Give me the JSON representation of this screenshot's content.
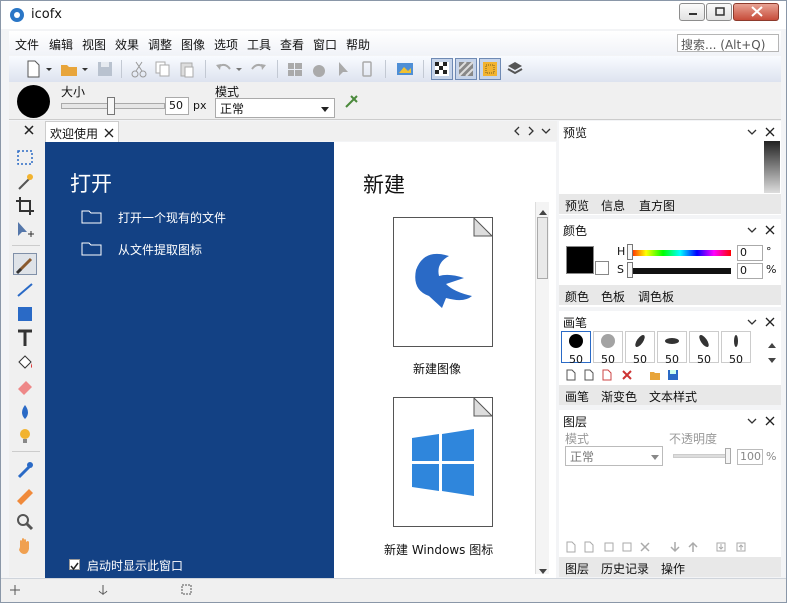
{
  "app": {
    "title": "icofx"
  },
  "menu": [
    "文件",
    "编辑",
    "视图",
    "效果",
    "调整",
    "图像",
    "选项",
    "工具",
    "查看",
    "窗口",
    "帮助"
  ],
  "search": {
    "placeholder": "搜索... (Alt+Q)"
  },
  "options": {
    "size_label": "大小",
    "size_value": "50",
    "size_unit": "px",
    "mode_label": "模式",
    "mode_value": "正常"
  },
  "tabs": {
    "welcome": "欢迎使用"
  },
  "welcome": {
    "open_title": "打开",
    "open_existing": "打开一个现有的文件",
    "extract_icon": "从文件提取图标",
    "show_on_startup": "启动时显示此窗口",
    "new_title": "新建",
    "new_image": "新建图像",
    "new_windows_icon": "新建 Windows 图标"
  },
  "preview_panel": {
    "title": "预览",
    "tabs": [
      "预览",
      "信息",
      "直方图"
    ]
  },
  "color_panel": {
    "title": "颜色",
    "h_label": "H",
    "h_value": "0",
    "h_unit": "°",
    "s_label": "S",
    "s_value": "0",
    "s_unit": "%",
    "tabs": [
      "颜色",
      "色板",
      "调色板"
    ]
  },
  "brush_panel": {
    "title": "画笔",
    "brushes": [
      "50",
      "50",
      "50",
      "50",
      "50",
      "50"
    ],
    "tabs": [
      "画笔",
      "渐变色",
      "文本样式"
    ]
  },
  "layers_panel": {
    "title": "图层",
    "mode_label": "模式",
    "mode_value": "正常",
    "opacity_label": "不透明度",
    "opacity_value": "100",
    "opacity_unit": "%",
    "tabs": [
      "图层",
      "历史记录",
      "操作"
    ]
  },
  "colors": {
    "accent": "#134184",
    "primary_color": "#000000"
  }
}
